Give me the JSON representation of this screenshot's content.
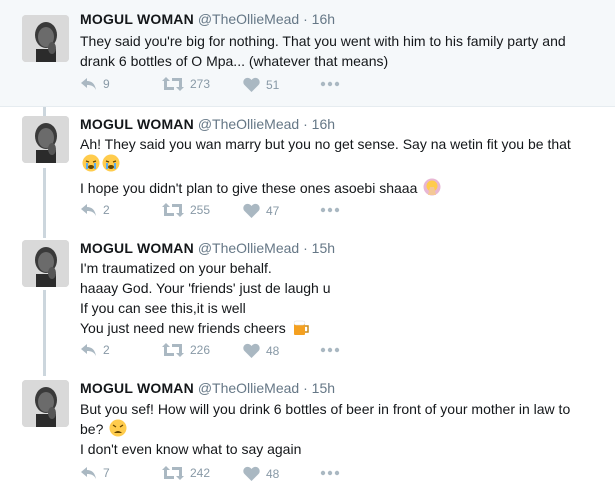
{
  "colors": {
    "accent": "#1da1f2",
    "thread_line": "#ccd6dd",
    "muted": "#8899a6"
  },
  "tweets": [
    {
      "name": "MOGUL WOMAN",
      "handle": "@TheOllieMead",
      "dot": "·",
      "time": "16h",
      "lines": [
        "They said you're big for nothing. That you went with him to his family party and",
        "drank 6 bottles of O Mpa... (whatever that means)"
      ],
      "reply_count": "9",
      "retweet_count": "273",
      "like_count": "51"
    },
    {
      "name": "MOGUL WOMAN",
      "handle": "@TheOllieMead",
      "dot": "·",
      "time": "16h",
      "lines": [
        "Ah! They said you wan marry but you no get sense. Say na wetin fit you be that",
        "",
        "I hope you didn't plan to give these ones asoebi shaaa"
      ],
      "line2_emojis": [
        "crying-face-emoji",
        "crying-face-emoji"
      ],
      "line3_emoji": "facepalm-emoji",
      "reply_count": "2",
      "retweet_count": "255",
      "like_count": "47"
    },
    {
      "name": "MOGUL WOMAN",
      "handle": "@TheOllieMead",
      "dot": "·",
      "time": "15h",
      "lines": [
        "I'm traumatized on your behalf.",
        "haaay God. Your 'friends' just de laugh u",
        "If you can see this,it is well",
        "You just need new friends cheers"
      ],
      "line4_emoji": "beer-mug-emoji",
      "reply_count": "2",
      "retweet_count": "226",
      "like_count": "48"
    },
    {
      "name": "MOGUL WOMAN",
      "handle": "@TheOllieMead",
      "dot": "·",
      "time": "15h",
      "lines": [
        "But you sef! How will you drink 6 bottles of beer in front of your mother in law to",
        "be?",
        "I don't even know what to say again"
      ],
      "line2_emoji": "weary-face-emoji",
      "reply_count": "7",
      "retweet_count": "242",
      "like_count": "48"
    }
  ]
}
